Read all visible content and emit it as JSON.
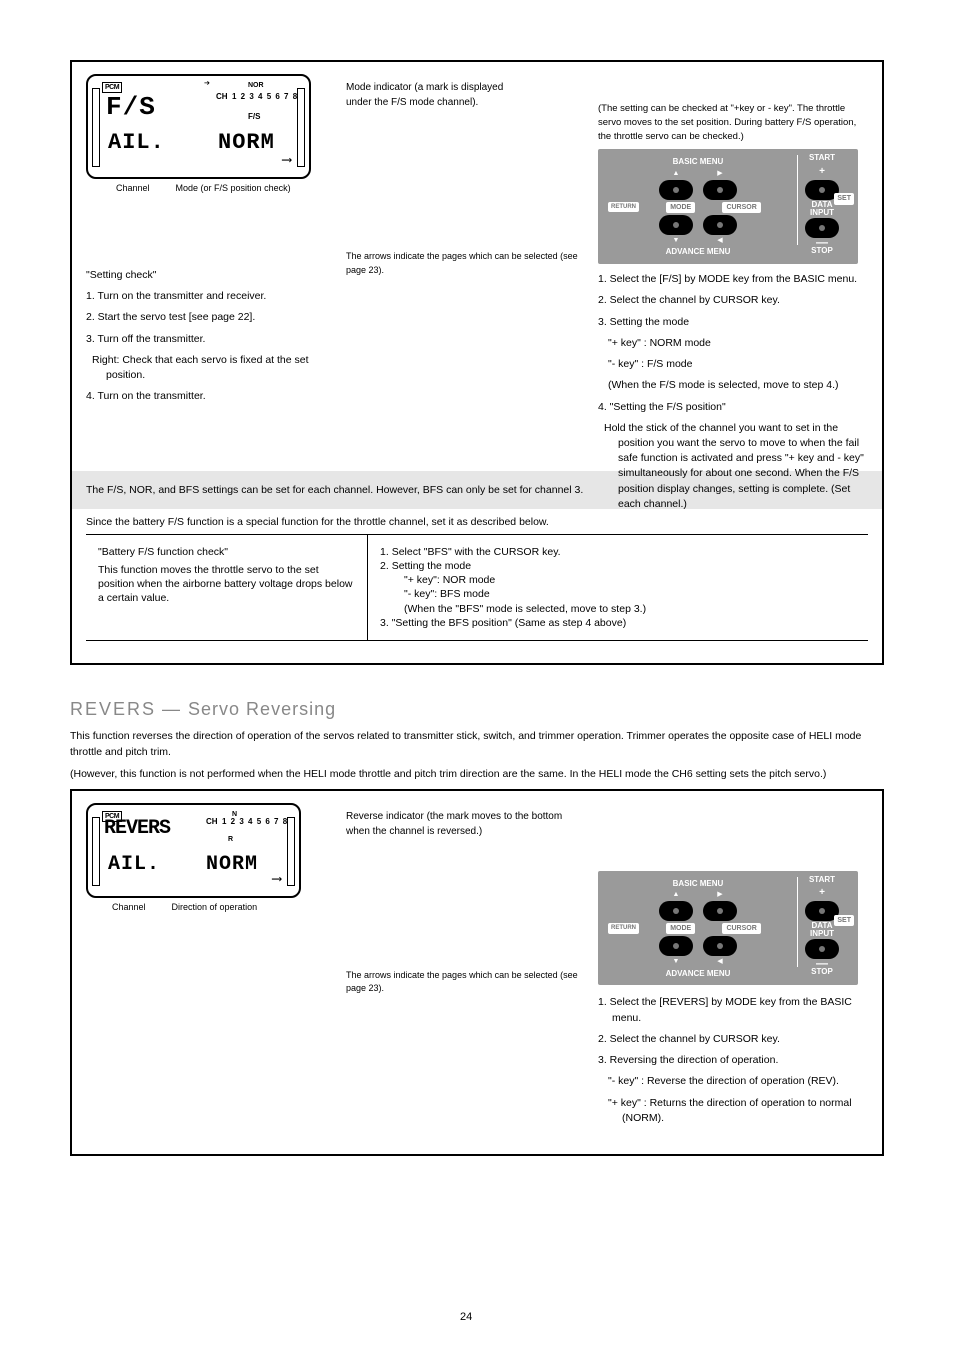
{
  "page_number": "24",
  "panel1": {
    "lcd": {
      "pcm": "PCM",
      "title": "F/S",
      "ch_label": "CH",
      "channels": "1 2 3 4 5 6 7 8",
      "nor_rev_top": "NOR",
      "fs_mid": "F/S",
      "row2_left": "AIL.",
      "row2_right": "NORM"
    },
    "lcd_annot": {
      "top1": "Mode indicator (a mark is displayed",
      "top2": "under the F/S mode channel).",
      "left": "Channel",
      "right": "Mode (or F/S position check)",
      "bottom": "The arrows indicate the pages which can be selected (see page 23)."
    },
    "labels_col": {
      "l1": "1. Turn on the transmitter and receiver.",
      "l2": "2. Start the servo test [see page 22].",
      "l3": "3. Turn off the transmitter.",
      "l4": "Right: Check that each servo is fixed at the set position.",
      "l5": "4. Turn on the transmitter."
    },
    "keypad": {
      "basic": "BASIC MENU",
      "advance": "ADVANCE MENU",
      "start": "START",
      "stop": "STOP",
      "return": "RETURN",
      "mode": "MODE",
      "cursor": "CURSOR",
      "data": "DATA",
      "input": "INPUT",
      "set": "SET"
    },
    "right_instr": {
      "header_note": "(The setting can be checked at \"+key or - key\". The throttle servo moves to the set position. During battery F/S operation, the throttle servo can be checked.)",
      "s1": "1. Select the [F/S] by MODE key from the BASIC menu.",
      "s2": "2. Select the channel by CURSOR key.",
      "s3a": "3. Setting the mode",
      "s3b": "\"+ key\" : NORM mode",
      "s3c": "\"- key\" : F/S mode",
      "s3d": "(When the F/S mode is selected, move to step 4.)",
      "s4a": "4. \"Setting the F/S position\"",
      "s4b": "Hold the stick of the channel you want to set in the position you want the servo to move to when the fail safe function is activated and press \"+ key and - key\" simultaneously for about one second. When the F/S position display changes, setting is complete. (Set each channel.)"
    },
    "gray_row": "The F/S, NOR, and BFS settings can be set for each channel. However, BFS can only be set for channel 3.",
    "table": {
      "l_h": "\"Battery F/S function check\"",
      "l_b": "This function moves the throttle servo to the set position when the airborne battery voltage drops below a certain value.",
      "r1": "1. Select \"BFS\" with the CURSOR key.",
      "r2": "2. Setting the mode",
      "r3": "\"+ key\": NOR mode",
      "r4": "\"- key\": BFS mode",
      "r5": "(When the \"BFS\" mode is selected, move to step 3.)",
      "r6": "3. \"Setting the BFS position\" (Same as step 4 above)"
    }
  },
  "section": {
    "title_a": "REVERS",
    "title_b": "Servo Reversing"
  },
  "revers_intro": {
    "p1": "This function reverses the direction of operation of the servos related to transmitter stick, switch, and trimmer operation. Trimmer operates the opposite case of HELI mode throttle and pitch trim.",
    "p2": "(However, this function is not performed when the HELI mode throttle and pitch trim direction are the same. In the HELI mode the CH6 setting sets the pitch servo.)"
  },
  "panel2": {
    "lcd": {
      "pcm": "PCM",
      "title": "REVERS",
      "ch_label": "CH",
      "channels": "1 2 3 4 5 6 7 8",
      "n": "N",
      "r": "R",
      "row2_left": "AIL.",
      "row2_right": "NORM"
    },
    "lcd_annot": {
      "top": "Reverse indicator (the mark moves to the bottom when the channel is reversed.)",
      "left": "Channel",
      "right": "Direction of operation",
      "bottom": "The arrows indicate the pages which can be selected (see page 23)."
    },
    "right_instr": {
      "s1": "1. Select the [REVERS] by MODE key from the BASIC menu.",
      "s2": "2. Select the channel by CURSOR key.",
      "s3a": "3. Reversing the direction of operation.",
      "s3b": "\"- key\" : Reverse the direction of operation (REV).",
      "s3c": "\"+ key\" : Returns the direction of operation to normal (NORM)."
    }
  }
}
